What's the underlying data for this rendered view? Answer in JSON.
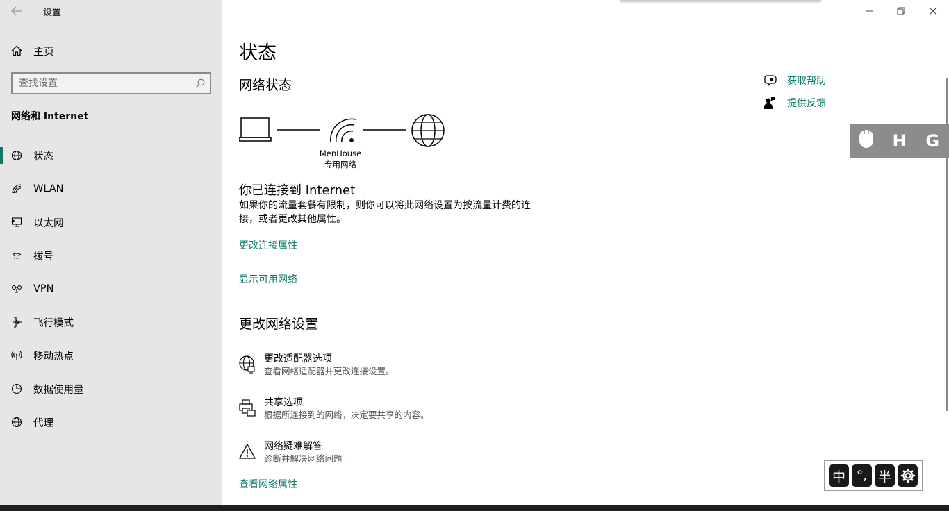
{
  "window": {
    "title": "设置"
  },
  "sidebar": {
    "home_label": "主页",
    "search_placeholder": "查找设置",
    "section_title": "网络和 Internet",
    "items": [
      {
        "label": "状态",
        "icon": "globe-status-icon",
        "active": true
      },
      {
        "label": "WLAN",
        "icon": "wifi-icon"
      },
      {
        "label": "以太网",
        "icon": "ethernet-icon"
      },
      {
        "label": "拨号",
        "icon": "dialup-icon"
      },
      {
        "label": "VPN",
        "icon": "vpn-icon"
      },
      {
        "label": "飞行模式",
        "icon": "airplane-icon"
      },
      {
        "label": "移动热点",
        "icon": "hotspot-icon"
      },
      {
        "label": "数据使用量",
        "icon": "data-usage-icon"
      },
      {
        "label": "代理",
        "icon": "proxy-globe-icon"
      }
    ]
  },
  "main": {
    "page_title": "状态",
    "network_status_title": "网络状态",
    "network_name": "MenHouse",
    "network_type": "专用网络",
    "connected_title": "你已连接到 Internet",
    "connected_desc": "如果你的流量套餐有限制，则你可以将此网络设置为按流量计费的连接，或者更改其他属性。",
    "link_change_props": "更改连接属性",
    "link_show_available": "显示可用网络",
    "change_settings_title": "更改网络设置",
    "options": [
      {
        "title": "更改适配器选项",
        "desc": "查看网络适配器并更改连接设置。",
        "icon": "adapter-globe-icon"
      },
      {
        "title": "共享选项",
        "desc": "根据所连接到的网络，决定要共享的内容。",
        "icon": "sharing-printer-icon"
      },
      {
        "title": "网络疑难解答",
        "desc": "诊断并解决网络问题。",
        "icon": "warning-triangle-icon"
      }
    ],
    "link_view_props": "查看网络属性"
  },
  "help": {
    "get_help": "获取帮助",
    "feedback": "提供反馈"
  },
  "float_toolbar": {
    "h": "H",
    "g": "G"
  },
  "ime": {
    "mode": "中",
    "punct": "°,",
    "width": "半"
  },
  "colors": {
    "accent": "#0b7a6a",
    "sidebar_bg": "#e6e6e6"
  }
}
